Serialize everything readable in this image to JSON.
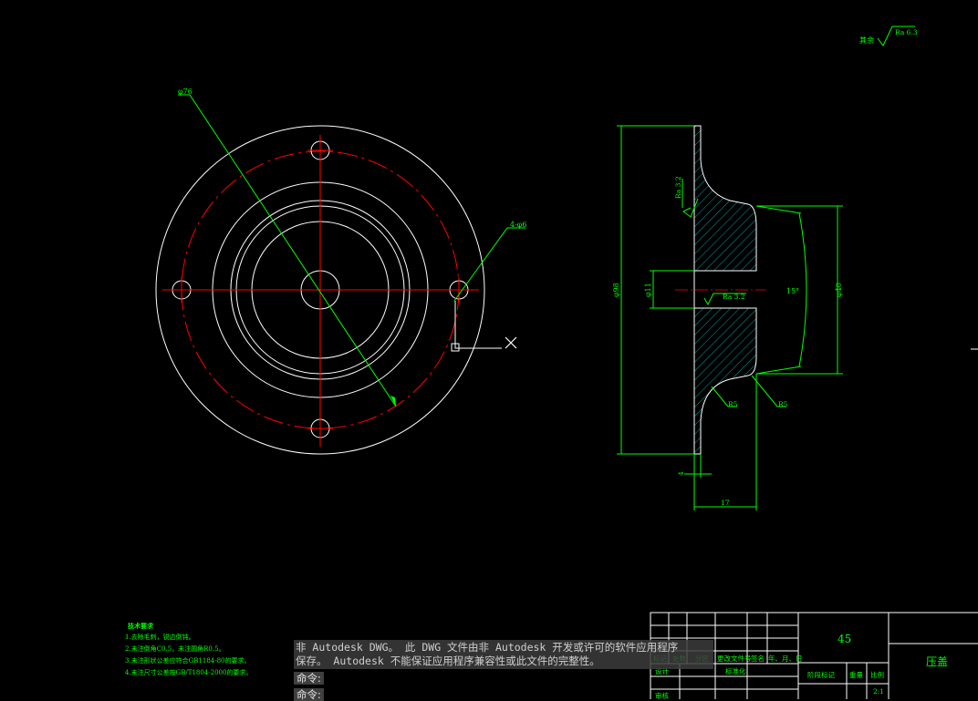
{
  "annotations": {
    "surface_finish_global_label": "其余",
    "surface_finish_global_value": "Ra 6.3",
    "bolt_circle_dia": "φ76",
    "holes": "4-φ6",
    "finish_face": "Ra 3.2",
    "finish_bore": "Ra 3.2",
    "overall_dia": "φ98",
    "bore_dia": "φ11",
    "hub_dia": "φ40",
    "taper_angle": "15°",
    "fillet_1": "R5",
    "fillet_2": "R5",
    "flange_thk": "4",
    "overall_len": "17"
  },
  "tech_requirements": {
    "title": "技术要求",
    "items": [
      "1.去除毛刺，锐边倒钝。",
      "2.未注倒角C0.5，未注圆角R0.5。",
      "3.未注形状公差应符合GB1184-80的要求。",
      "4.未注尺寸公差按GB/T1804-2000的要求。"
    ]
  },
  "title_block": {
    "material": "45",
    "part_name": "压盖",
    "row_labels": [
      "标记",
      "处数",
      "分区",
      "更改文件号",
      "签名",
      "年、月、日"
    ],
    "design": "设计",
    "standardize": "标准化",
    "stage_mark": "阶段标记",
    "weight": "重量",
    "scale_label": "比例",
    "scale_value": "2:1",
    "review": "审核"
  },
  "command": {
    "warning_line1": "非 Autodesk DWG。  此 DWG 文件由非 Autodesk 开发或许可的软件应用程序",
    "warning_line2": "保存。  Autodesk 不能保证应用程序兼容性或此文件的完整性。",
    "prompt1": "命令:",
    "prompt2": "命令:"
  }
}
